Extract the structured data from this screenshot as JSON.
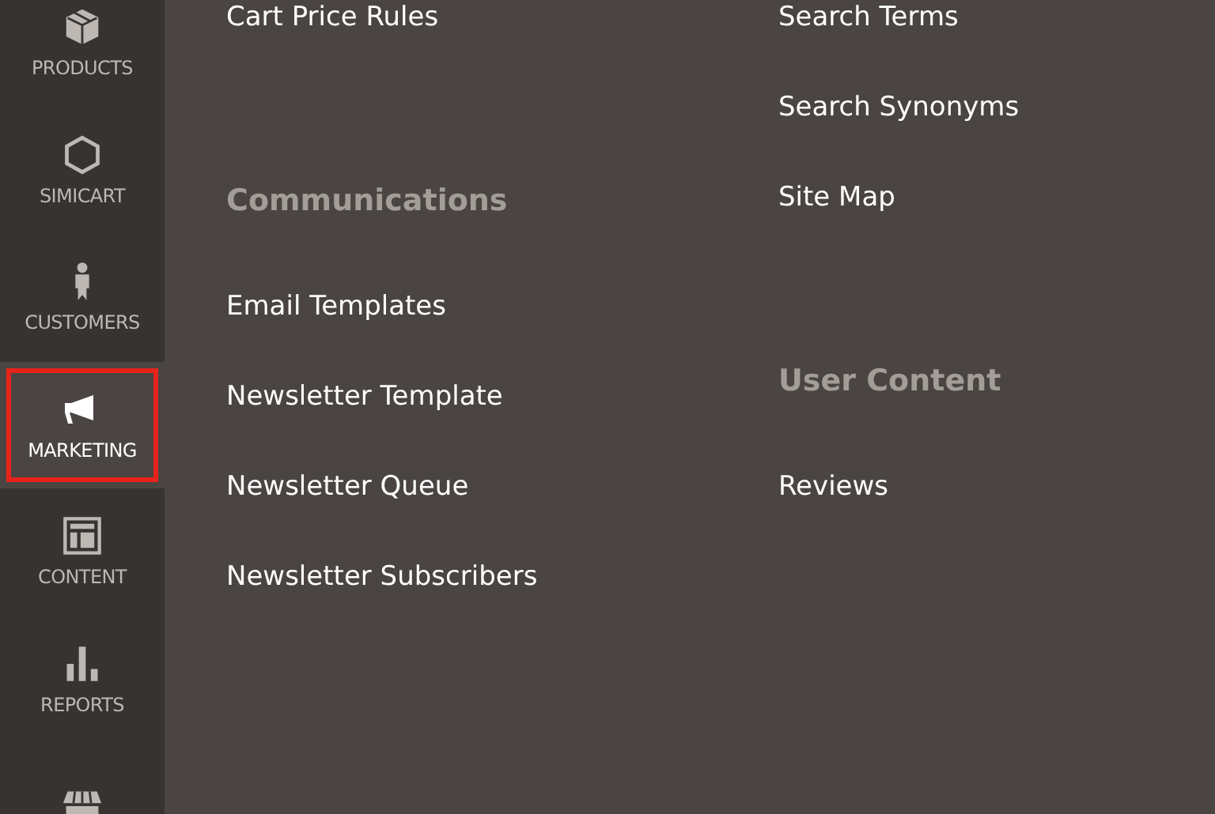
{
  "sidebar": {
    "items": [
      {
        "label": "PRODUCTS",
        "kind": "box",
        "selected": false,
        "highlighted": false
      },
      {
        "label": "SIMICART",
        "kind": "hexagon",
        "selected": false,
        "highlighted": false
      },
      {
        "label": "CUSTOMERS",
        "kind": "person",
        "selected": false,
        "highlighted": false
      },
      {
        "label": "MARKETING",
        "kind": "megaphone",
        "selected": true,
        "highlighted": true
      },
      {
        "label": "CONTENT",
        "kind": "layout",
        "selected": false,
        "highlighted": false
      },
      {
        "label": "REPORTS",
        "kind": "bars",
        "selected": false,
        "highlighted": false
      },
      {
        "kind": "store",
        "selected": false,
        "highlighted": false
      }
    ]
  },
  "menu": {
    "columns": [
      [
        {
          "kind": "link",
          "text": "Cart Price Rules"
        },
        {
          "kind": "heading",
          "text": "Communications"
        },
        {
          "kind": "link",
          "text": "Email Templates"
        },
        {
          "kind": "link",
          "text": "Newsletter Template"
        },
        {
          "kind": "link",
          "text": "Newsletter Queue"
        },
        {
          "kind": "link",
          "text": "Newsletter Subscribers"
        }
      ],
      [
        {
          "kind": "link",
          "text": "Search Terms"
        },
        {
          "kind": "link",
          "text": "Search Synonyms"
        },
        {
          "kind": "link",
          "text": "Site Map"
        },
        {
          "kind": "heading",
          "text": "User Content"
        },
        {
          "kind": "link",
          "text": "Reviews"
        }
      ]
    ]
  }
}
